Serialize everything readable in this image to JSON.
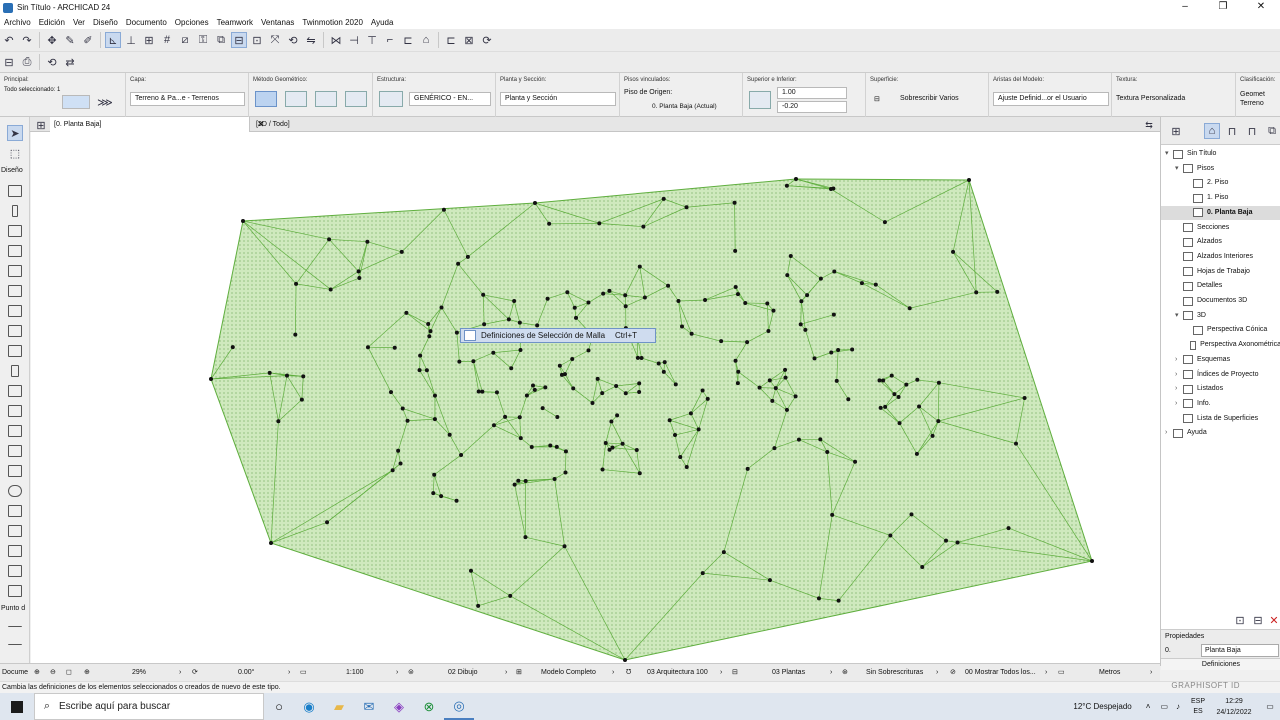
{
  "window": {
    "title": "Sin Título - ARCHICAD 24"
  },
  "menu": [
    "Archivo",
    "Edición",
    "Ver",
    "Diseño",
    "Documento",
    "Opciones",
    "Teamwork",
    "Ventanas",
    "Twinmotion 2020",
    "Ayuda"
  ],
  "infobox": {
    "principal_label": "Principal:",
    "selected_label": "Todo seleccionado: 1",
    "capa_label": "Capa:",
    "capa_value": "Terreno & Pa...e - Terrenos",
    "metodo_label": "Método Geométrico:",
    "estructura_label": "Estructura:",
    "estructura_value": "GENÉRICO - EN...",
    "planta_label": "Planta y Sección:",
    "planta_value": "Planta y Sección",
    "pisos_label": "Pisos vinculados:",
    "piso_origen_label": "Piso de Origen:",
    "piso_origen_value": "0. Planta Baja (Actual)",
    "superior_label": "Superior e Inferior:",
    "superior_value": "1.00",
    "inferior_value": "-0.20",
    "superficie_label": "Superficie:",
    "superficie_value": "Sobrescribir Varios",
    "aristas_label": "Aristas del Modelo:",
    "aristas_value": "Ajuste Definid...or el Usuario",
    "textura_label": "Textura:",
    "textura_value": "Textura Personalizada",
    "clasificacion_label": "Clasificación:",
    "clasificacion_value1": "Geomet",
    "clasificacion_value2": "Terreno"
  },
  "toolbox": {
    "diseno_label": "Diseño",
    "punto_label": "Punto d",
    "docume_label": "Docume"
  },
  "tabs": {
    "plan": "[0. Planta Baja]",
    "view3d": "[3D / Todo]"
  },
  "context_menu": {
    "label": "Definiciones de Selección de Malla",
    "shortcut": "Ctrl+T"
  },
  "navigator": {
    "items": [
      {
        "label": "Sin Título",
        "level": 0,
        "arrow": "▾"
      },
      {
        "label": "Pisos",
        "level": 1,
        "arrow": "▾"
      },
      {
        "label": "2. Piso",
        "level": 2,
        "arrow": ""
      },
      {
        "label": "1. Piso",
        "level": 2,
        "arrow": ""
      },
      {
        "label": "0. Planta Baja",
        "level": 2,
        "arrow": "",
        "selected": true
      },
      {
        "label": "Secciones",
        "level": 1,
        "arrow": ""
      },
      {
        "label": "Alzados",
        "level": 1,
        "arrow": ""
      },
      {
        "label": "Alzados Interiores",
        "level": 1,
        "arrow": ""
      },
      {
        "label": "Hojas de Trabajo",
        "level": 1,
        "arrow": ""
      },
      {
        "label": "Detalles",
        "level": 1,
        "arrow": ""
      },
      {
        "label": "Documentos 3D",
        "level": 1,
        "arrow": ""
      },
      {
        "label": "3D",
        "level": 1,
        "arrow": "▾"
      },
      {
        "label": "Perspectiva Cónica",
        "level": 2,
        "arrow": ""
      },
      {
        "label": "Perspectiva Axonométrica",
        "level": 2,
        "arrow": ""
      },
      {
        "label": "Esquemas",
        "level": 1,
        "arrow": "›"
      },
      {
        "label": "Índices de Proyecto",
        "level": 1,
        "arrow": "›"
      },
      {
        "label": "Listados",
        "level": 1,
        "arrow": "›"
      },
      {
        "label": "Info.",
        "level": 1,
        "arrow": "›"
      },
      {
        "label": "Lista de Superficies",
        "level": 1,
        "arrow": ""
      },
      {
        "label": "Ayuda",
        "level": 0,
        "arrow": "›"
      }
    ],
    "props_label": "Propiedades",
    "props_id": "0.",
    "props_value": "Planta Baja",
    "props_button": "Definiciones"
  },
  "status": {
    "zoom": "29%",
    "angle": "0.00°",
    "scale": "1:100",
    "layer_combo": "02 Dibujo",
    "model_view": "Modelo Completo",
    "pen_set": "03 Arquitectura 100",
    "structure": "03 Plantas",
    "overrides": "Sin Sobrescrituras",
    "renovation": "00 Mostrar Todos los...",
    "units": "Metros"
  },
  "hint": "Cambia las definiciones de los elementos seleccionados o creados de nuevo de este tipo.",
  "brand": "GRAPHISOFT ID",
  "taskbar": {
    "search_placeholder": "Escribe aquí para buscar",
    "weather": "12°C  Despejado",
    "lang1": "ESP",
    "lang2": "ES",
    "time": "12:29",
    "date": "24/12/2022"
  },
  "colors": {
    "mesh_fill": "#c7e6b4",
    "mesh_line": "#4caa2e",
    "selection": "#cfdcef"
  }
}
